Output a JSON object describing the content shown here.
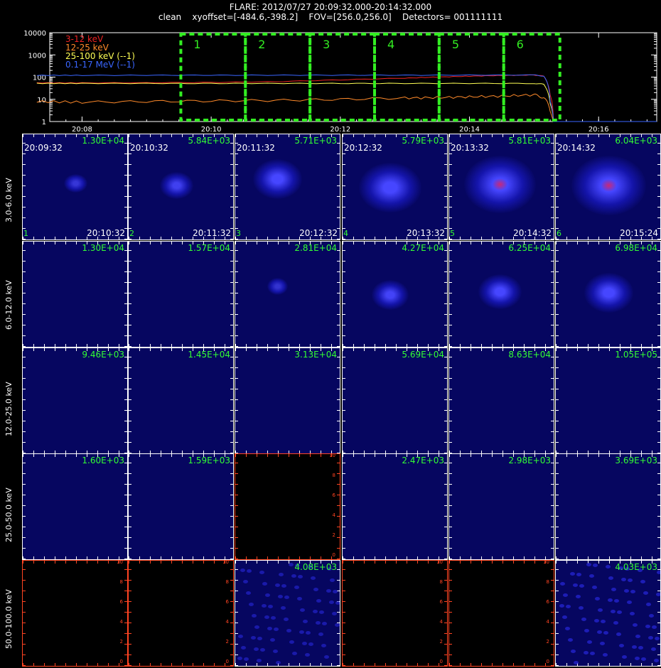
{
  "header": {
    "line1": "FLARE: 2012/07/27 20:09:32.000-20:14:32.000",
    "line2": "clean    xyoffset=[-484.6,-398.2]    FOV=[256.0,256.0]    Detectors= 001111111"
  },
  "colors": {
    "background": "#000000",
    "grid_ticks": "#ffffff",
    "peak_label": "#33ff33",
    "interval_box": "#33ee22",
    "ch_3_12": "#ee2222",
    "ch_12_25": "#ff8a2a",
    "ch_25_100": "#ffff55",
    "ch_0_1_17": "#3a66ff",
    "image_bg": "#060660",
    "empty_panel": "#000000",
    "empty_axis": "#ff4422"
  },
  "chart_data": [
    {
      "type": "line",
      "name": "lightcurve",
      "ylog": true,
      "ylim": [
        1,
        10000
      ],
      "xlim_minutes": [
        20.0,
        20.28
      ],
      "yticks": [
        "10000",
        "1000",
        "100",
        "10",
        "1"
      ],
      "xticks": [
        "20:08",
        "20:10",
        "20:12",
        "20:14",
        "20:16"
      ],
      "xtick_minutes": [
        8,
        10,
        12,
        14,
        16
      ],
      "legend": [
        {
          "label": "3-12 keV",
          "color": "#ee2222"
        },
        {
          "label": "12-25 keV",
          "color": "#ff8a2a"
        },
        {
          "label": "25-100 keV (--1)",
          "color": "#ffff55"
        },
        {
          "label": "0.1-17 MeV (--1)",
          "color": "#3a66ff"
        }
      ],
      "series": [
        {
          "name": "3-12 keV",
          "x": [
            7.3,
            8.0,
            9.0,
            10.0,
            11.0,
            12.0,
            13.0,
            13.5,
            14.0,
            14.5,
            15.0,
            15.15,
            15.25,
            15.3
          ],
          "y": [
            55,
            55,
            56,
            58,
            62,
            75,
            90,
            100,
            110,
            118,
            125,
            110,
            15,
            1
          ]
        },
        {
          "name": "12-25 keV",
          "x": [
            7.3,
            8.0,
            9.0,
            10.0,
            11.0,
            12.0,
            13.0,
            13.5,
            14.0,
            14.5,
            15.0,
            15.15,
            15.25,
            15.3
          ],
          "y": [
            8,
            7.5,
            8,
            8.5,
            9,
            10,
            11.5,
            12,
            13,
            14,
            16,
            12,
            3,
            1
          ]
        },
        {
          "name": "25-100 keV (--1)",
          "x": [
            7.3,
            8.0,
            9.0,
            10.0,
            11.0,
            12.0,
            13.0,
            14.0,
            15.0,
            15.15,
            15.25,
            15.3
          ],
          "y": [
            52,
            52,
            52,
            52,
            52,
            52,
            52,
            52,
            52,
            48,
            6,
            1
          ]
        },
        {
          "name": "0.1-17 MeV (--1)",
          "x": [
            7.3,
            8.0,
            9.0,
            10.0,
            11.0,
            12.0,
            13.0,
            14.0,
            15.0,
            15.15,
            15.25,
            15.3
          ],
          "y": [
            120,
            120,
            121,
            122,
            122,
            122,
            122,
            123,
            125,
            110,
            8,
            1
          ]
        }
      ],
      "intervals": [
        {
          "label": "1",
          "start": 9.53,
          "end": 10.53
        },
        {
          "label": "2",
          "start": 10.53,
          "end": 11.53
        },
        {
          "label": "3",
          "start": 11.53,
          "end": 12.53
        },
        {
          "label": "4",
          "start": 12.53,
          "end": 13.53
        },
        {
          "label": "5",
          "start": 13.53,
          "end": 14.53
        },
        {
          "label": "6",
          "start": 14.53,
          "end": 15.4
        }
      ]
    },
    {
      "type": "heatmap",
      "name": "image-grid",
      "energy_bands": [
        "3.0-6.0 keV",
        "6.0-12.0 keV",
        "12.0-25.0 keV",
        "25.0-50.0 keV",
        "50.0-100.0 keV"
      ],
      "time_starts": [
        "20:09:32",
        "20:10:32",
        "20:11:32",
        "20:12:32",
        "20:13:32",
        "20:14:32"
      ],
      "time_ends": [
        "20:10:32",
        "20:11:32",
        "20:12:32",
        "20:13:32",
        "20:14:32",
        "20:15:24"
      ],
      "panel_index": [
        "1",
        "2",
        "3",
        "4",
        "5",
        "6"
      ],
      "empty_axis_ticks": [
        "0",
        "2",
        "4",
        "6",
        "8",
        "10"
      ],
      "peaks": [
        [
          "1.30E+04",
          "5.84E+03",
          "5.71E+03",
          "5.79E+03",
          "5.81E+03",
          "6.04E+03"
        ],
        [
          "1.30E+04",
          "1.57E+04",
          "2.81E+04",
          "4.27E+04",
          "6.25E+04",
          "6.98E+04"
        ],
        [
          "9.46E+03",
          "1.45E+04",
          "3.13E+04",
          "5.69E+04",
          "8.63E+04",
          "1.05E+05"
        ],
        [
          "1.60E+03",
          "1.59E+03",
          "",
          "2.47E+03",
          "2.98E+03",
          "3.69E+03"
        ],
        [
          "",
          "",
          "4.08E+03",
          "",
          "",
          "4.03E+03"
        ]
      ],
      "intensity": [
        [
          0.15,
          0.3,
          0.55,
          0.75,
          0.9,
          0.95
        ],
        [
          0.0,
          0.0,
          0.1,
          0.35,
          0.45,
          0.55
        ],
        [
          0.0,
          0.0,
          0.0,
          0.0,
          0.0,
          0.0
        ],
        [
          0.0,
          0.0,
          -1,
          0.0,
          0.0,
          0.0
        ],
        [
          -1,
          -1,
          0.25,
          -1,
          -1,
          0.35
        ]
      ]
    }
  ]
}
